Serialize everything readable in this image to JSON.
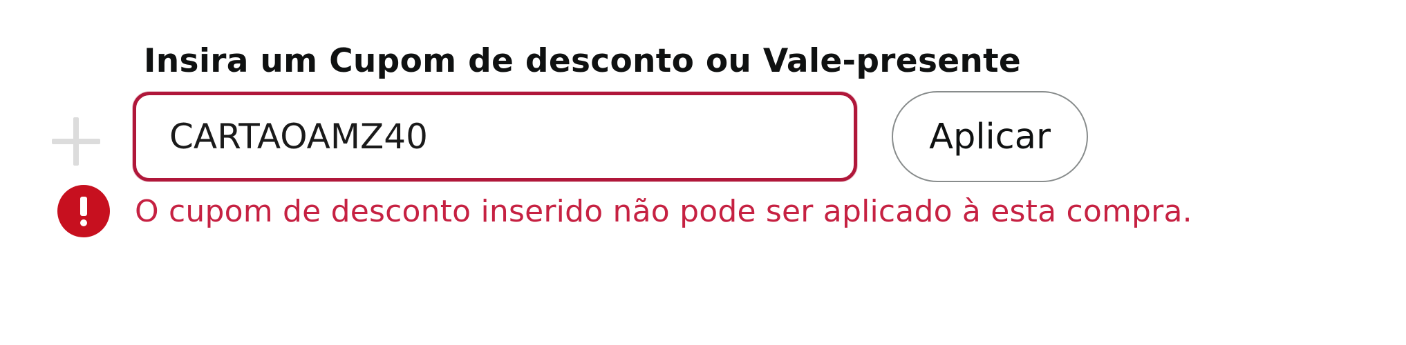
{
  "coupon": {
    "heading": "Insira um Cupom de desconto ou Vale-presente",
    "input_value": "CARTAOAMZ40",
    "apply_label": "Aplicar",
    "error_message": "O cupom de desconto inserido não pode ser aplicado à esta compra."
  },
  "icons": {
    "expand": "plus-icon",
    "error": "error-alert-icon"
  },
  "colors": {
    "error_border": "#b0173a",
    "error_text": "#c62142",
    "error_icon": "#c7101f",
    "button_border": "#888c8c"
  }
}
